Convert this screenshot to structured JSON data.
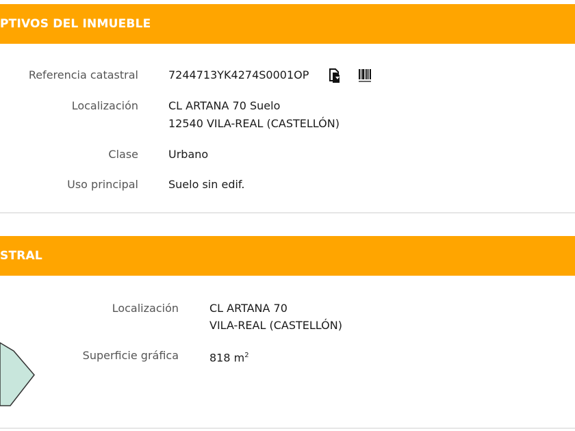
{
  "section1": {
    "title": "PTIVOS DEL INMUEBLE",
    "rows": [
      {
        "label": "Referencia catastral",
        "value": "7244713YK4274S0001OP"
      },
      {
        "label": "Localización",
        "line1": "CL ARTANA 70 Suelo",
        "line2": "12540 VILA-REAL (CASTELLÓN)"
      },
      {
        "label": "Clase",
        "value": "Urbano"
      },
      {
        "label": "Uso principal",
        "value": "Suelo sin edif."
      }
    ],
    "icons": {
      "copy": "copy-document-icon",
      "barcode": "barcode-icon"
    }
  },
  "section2": {
    "title": "STRAL",
    "rows": [
      {
        "label": "Localización",
        "line1": "CL ARTANA 70",
        "line2": "VILA-REAL (CASTELLÓN)"
      },
      {
        "label": "Superficie gráfica",
        "value": "818 m",
        "unit_sup": "2"
      }
    ],
    "parcel_color": "#c8e6dc"
  },
  "colors": {
    "banner": "#ffa500",
    "label": "#555555"
  }
}
